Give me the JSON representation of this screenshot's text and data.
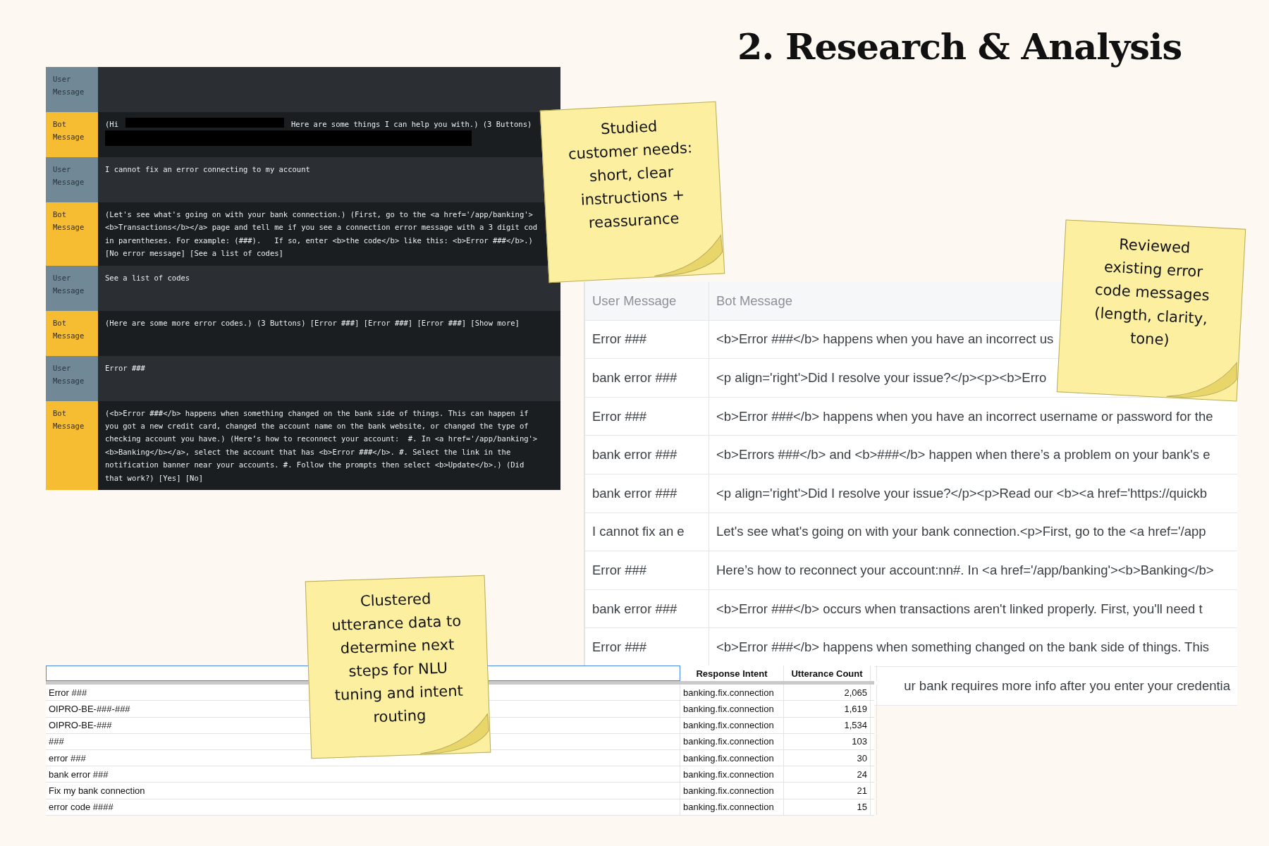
{
  "title": "2. Research & Analysis",
  "chat": [
    {
      "kind": "user",
      "label": "User Message"
    },
    {
      "kind": "bot",
      "label": "Bot Message",
      "segments": [
        [
          {
            "kind": "text",
            "text": "(Hi"
          },
          {
            "kind": "redaction-name"
          },
          {
            "kind": "text",
            "text": "Here are some things I can help you with.) (3 Buttons)"
          }
        ],
        [
          {
            "kind": "redaction-line"
          }
        ]
      ]
    },
    {
      "kind": "user",
      "label": "User Message",
      "lines": [
        "I cannot fix an error connecting to my account"
      ]
    },
    {
      "kind": "bot",
      "label": "Bot Message",
      "lines": [
        "(Let's see what's going on with your bank connection.) (First, go to the <a href='/app/banking'>",
        "<b>Transactions</b></a> page and tell me if you see a connection error message with a 3 digit cod",
        "in parentheses. For example: (###).   If so, enter <b>the code</b> like this: <b>Error ###</b>.)",
        "[No error message] [See a list of codes]"
      ]
    },
    {
      "kind": "user",
      "label": "User Message",
      "lines": [
        "See a list of codes"
      ]
    },
    {
      "kind": "bot",
      "label": "Bot Message",
      "lines": [
        "(Here are some more error codes.) (3 Buttons) [Error ###] [Error ###] [Error ###] [Show more]"
      ]
    },
    {
      "kind": "user",
      "label": "User Message",
      "lines": [
        "Error ###"
      ]
    },
    {
      "kind": "bot",
      "label": "Bot Message",
      "lines": [
        "(<b>Error ###</b> happens when something changed on the bank side of things. This can happen if",
        "you got a new credit card, changed the account name on the bank website, or changed the type of",
        "checking account you have.) (Here’s how to reconnect your account:  #. In <a href='/app/banking'>",
        "<b>Banking</b></a>, select the account that has <b>Error ###</b>. #. Select the link in the",
        "notification banner near your accounts. #. Follow the prompts then select <b>Update</b>.) (Did",
        "that work?) [Yes] [No]"
      ]
    }
  ],
  "notes": [
    {
      "lines": [
        "Studied",
        "customer needs:",
        "short, clear",
        "instructions +",
        "reassurance"
      ]
    },
    {
      "lines": [
        "Reviewed",
        "existing error",
        "code messages",
        "(length, clarity,",
        "tone)"
      ]
    },
    {
      "lines": [
        "Clustered",
        "utterance data to",
        "determine next",
        "steps for NLU",
        "tuning and intent",
        "routing"
      ]
    }
  ],
  "review_table": {
    "columns": [
      "User Message",
      "Bot Message"
    ],
    "rows": [
      {
        "user": "Error ###",
        "bot": "<b>Error ###</b> happens when you have an incorrect us"
      },
      {
        "user": "bank error ###",
        "bot": "<p align='right'>Did I resolve your issue?</p><p><b>Erro"
      },
      {
        "user": "Error ###",
        "bot": "<b>Error ###</b> happens when you have an incorrect username or password for the"
      },
      {
        "user": "bank error ###",
        "bot": "<b>Errors ###</b> and <b>###</b> happen when there’s a problem on your bank's e"
      },
      {
        "user": "bank error ###",
        "bot": "<p align='right'>Did I resolve your issue?</p><p>Read our <b><a href='https://quickb"
      },
      {
        "user": "I cannot fix an e",
        "bot": "Let's see what's going on with your bank connection.<p>First, go to the <a href='/app"
      },
      {
        "user": "Error ###",
        "bot": "Here’s how to reconnect your account:nn#. In <a href='/app/banking'><b>Banking</b>"
      },
      {
        "user": "bank error ###",
        "bot": "<b>Error ###</b> occurs when transactions aren't linked properly. First, you'll need t"
      },
      {
        "user": "Error ###",
        "bot": "<b>Error ###</b> happens when something changed on the bank side of things. This"
      },
      {
        "bot": "ur bank requires more info after you enter your credentia"
      }
    ]
  },
  "utterance_table": {
    "columns": [
      "Response Intent",
      "Utterance Count"
    ],
    "rows": [
      {
        "utterance": "Error ###",
        "intent": "banking.fix.connection",
        "count": "2,065"
      },
      {
        "utterance": "OIPRO-BE-###-###",
        "intent": "banking.fix.connection",
        "count": "1,619"
      },
      {
        "utterance": "OIPRO-BE-###",
        "intent": "banking.fix.connection",
        "count": "1,534"
      },
      {
        "utterance": "###",
        "intent": "banking.fix.connection",
        "count": "103"
      },
      {
        "utterance": "error ###",
        "intent": "banking.fix.connection",
        "count": "30"
      },
      {
        "utterance": "bank error ###",
        "intent": "banking.fix.connection",
        "count": "24"
      },
      {
        "utterance": "Fix my bank connection",
        "intent": "banking.fix.connection",
        "count": "21"
      },
      {
        "utterance": "error code ####",
        "intent": "banking.fix.connection",
        "count": "15"
      }
    ]
  }
}
